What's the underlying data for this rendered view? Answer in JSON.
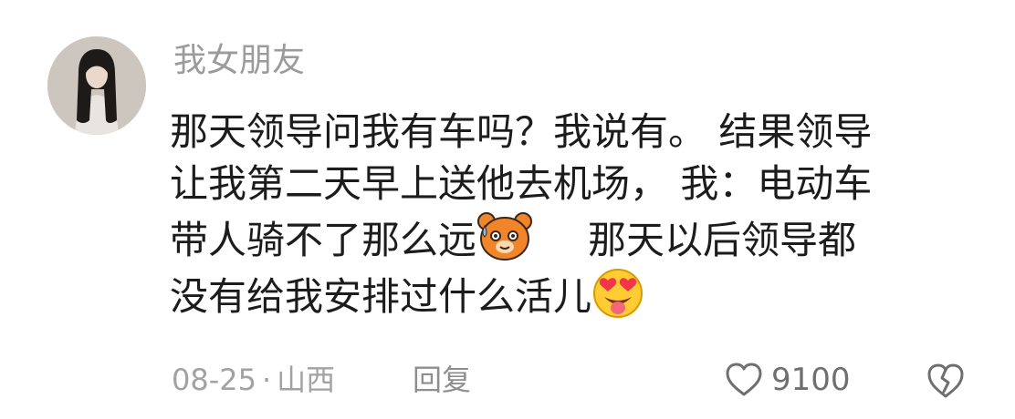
{
  "comment": {
    "username": "我女朋友",
    "text_lines": [
      "那天领导问我有车吗？我说有。 结果领导",
      "让我第二天早上送他去机场， 我：电动车",
      "带人骑不了那么远",
      "那天以后领导都",
      "没有给我安排过什么活儿"
    ],
    "emojis": [
      "bear-sweat-emoji",
      "heart-eyes-tongue-emoji"
    ],
    "date": "08-25",
    "separator": "·",
    "location": "山西",
    "reply_label": "回复",
    "like_count": "9100"
  },
  "icons": {
    "like": "heart-outline-icon",
    "dislike": "broken-heart-icon"
  },
  "colors": {
    "username": "#9b9b9b",
    "text": "#1c1c1c",
    "meta": "#a2a2a2",
    "bear": "#f0852a",
    "heart": "#f2354a"
  }
}
